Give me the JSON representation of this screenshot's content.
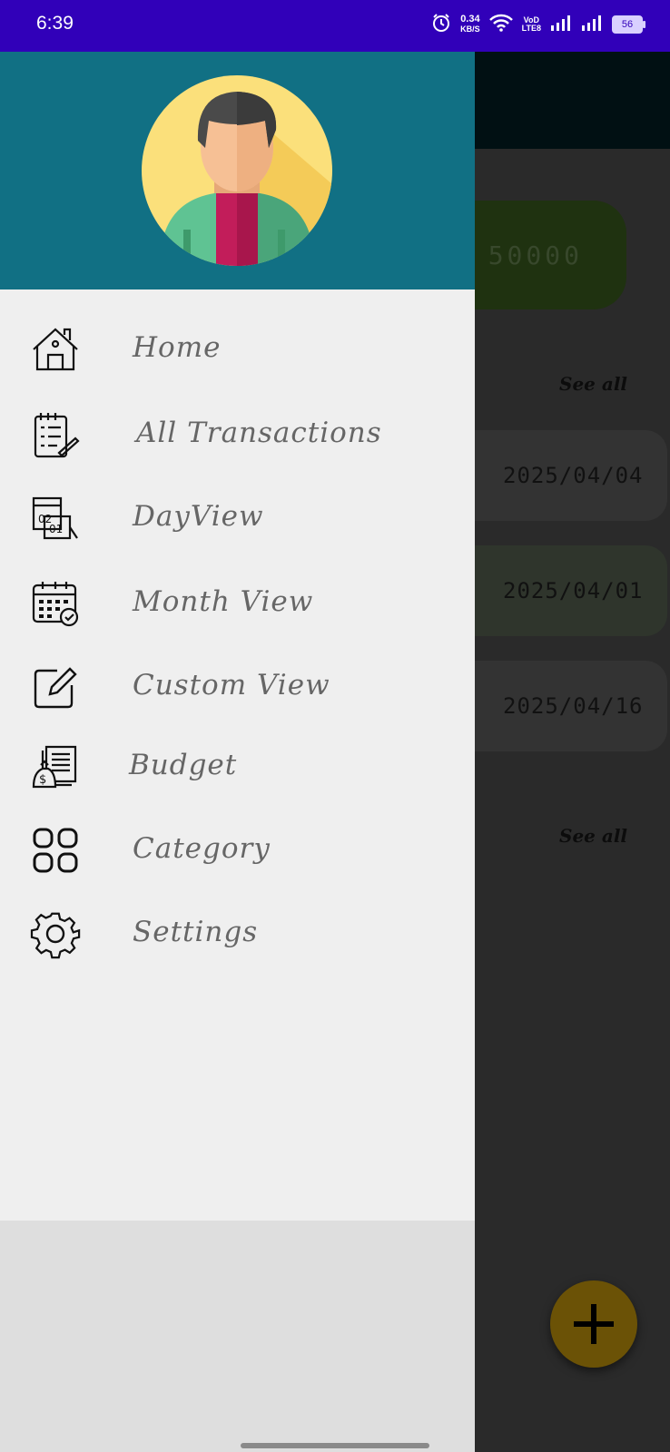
{
  "status_bar": {
    "time": "6:39",
    "speed_value": "0.34",
    "speed_unit": "KB/S",
    "network_label_top": "VoD",
    "network_label_bottom": "LTE8",
    "battery": "56",
    "icons": [
      "alarm-icon",
      "wifi-icon",
      "signal-icon",
      "signal-icon",
      "battery-icon"
    ]
  },
  "background_app": {
    "balance": "50000",
    "see_all_1": "See all",
    "see_all_2": "See all",
    "transactions": [
      {
        "date": "2025/04/04"
      },
      {
        "date": "2025/04/01"
      },
      {
        "date": "2025/04/16"
      }
    ],
    "fab_icon": "plus-icon"
  },
  "drawer": {
    "header_color": "#117084",
    "avatar_icon": "user-avatar-icon",
    "items": [
      {
        "label": "Home",
        "icon": "house-icon"
      },
      {
        "label": "All Transactions",
        "icon": "checklist-icon"
      },
      {
        "label": "DayView",
        "icon": "day-calendar-icon"
      },
      {
        "label": "Month View",
        "icon": "month-calendar-icon"
      },
      {
        "label": "Custom View",
        "icon": "edit-icon"
      },
      {
        "label": "Budget",
        "icon": "budget-book-icon"
      },
      {
        "label": "Category",
        "icon": "grid-icon"
      },
      {
        "label": "Settings",
        "icon": "gear-icon"
      }
    ]
  },
  "colors": {
    "status_bar": "#3100b9",
    "drawer_header": "#117084",
    "fab": "#6b5206"
  }
}
